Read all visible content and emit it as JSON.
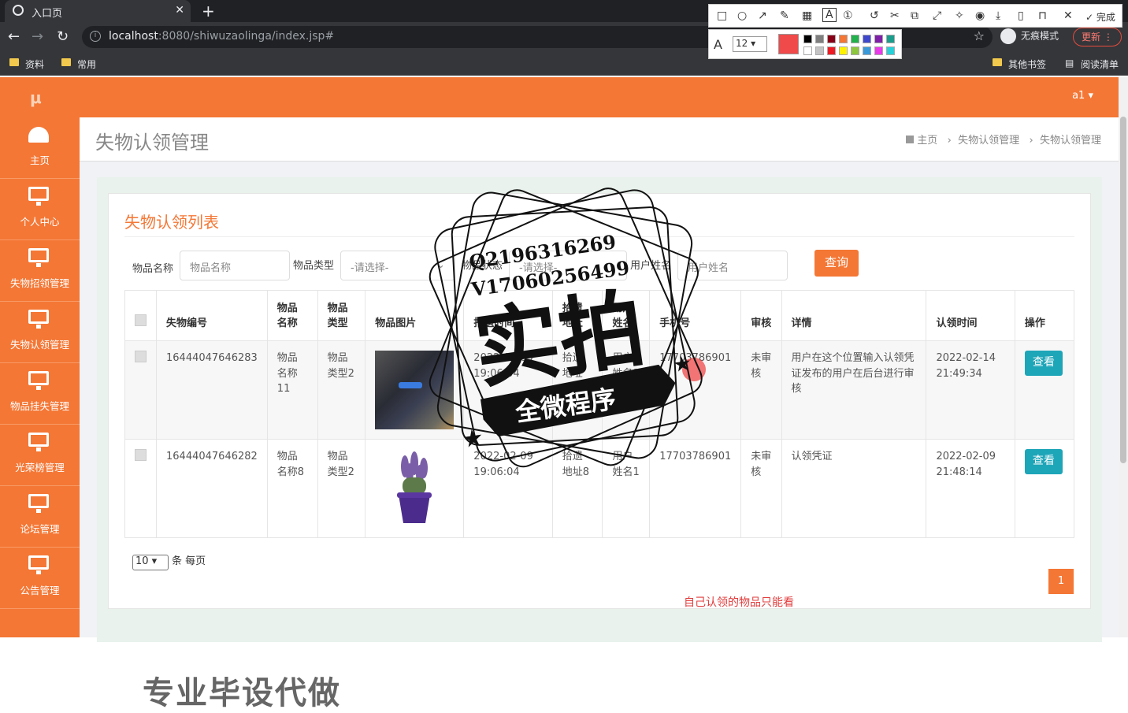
{
  "browser": {
    "tab_title": "入口页",
    "close_glyph": "✕",
    "new_tab_glyph": "+",
    "url_host": "localhost",
    "url_rest": ":8080/shiwuzaolinga/index.jsp#",
    "incognito": "无痕模式",
    "update": "更新",
    "bookmarks": [
      "资料",
      "常用"
    ],
    "other_bookmarks": "其他书签",
    "reading_list": "阅读清单"
  },
  "snap_tool": {
    "font_size": "12",
    "done": "完成",
    "selected_color": "#f04a4a"
  },
  "app": {
    "logo": "μ",
    "user": "a1 ▾",
    "sidebar": [
      "主页",
      "个人中心",
      "失物招领管理",
      "失物认领管理",
      "物品挂失管理",
      "光荣榜管理",
      "论坛管理",
      "公告管理"
    ],
    "page_title": "失物认领管理",
    "breadcrumb": [
      "主页",
      "失物认领管理",
      "失物认领管理"
    ],
    "list_title": "失物认领列表",
    "filters": {
      "name_label": "物品名称",
      "name_placeholder": "物品名称",
      "type_label": "物品类型",
      "type_value": "-请选择-",
      "status_label": "物品状态",
      "status_value": "-请选择-",
      "user_label": "用户姓名",
      "user_placeholder": "用户姓名",
      "query": "查询"
    },
    "columns": [
      "失物编号",
      "物品名称",
      "物品类型",
      "物品图片",
      "拾遗时间",
      "拾遗地址",
      "用户姓名",
      "手机号",
      "审核",
      "详情",
      "认领时间",
      "操作"
    ],
    "rows": [
      {
        "id": "16444047646283",
        "name": "物品名称11",
        "type": "物品类型2",
        "time": "2022-02-09 19:06:04",
        "addr": "拾遗地址11",
        "user": "用户姓名1",
        "phone": "17703786901",
        "audit": "未审核",
        "detail": "用户在这个位置输入认领凭证发布的用户在后台进行审核",
        "claim": "2022-02-14 21:49:34",
        "action": "查看"
      },
      {
        "id": "16444047646282",
        "name": "物品名称8",
        "type": "物品类型2",
        "time": "2022-02-09 19:06:04",
        "addr": "拾遗地址8",
        "user": "用户姓名1",
        "phone": "17703786901",
        "audit": "未审核",
        "detail": "认领凭证",
        "claim": "2022-02-09 21:48:14",
        "action": "查看"
      }
    ],
    "per_page_value": "10",
    "per_page_label": "条 每页",
    "page": "1",
    "note": "自己认领的物品只能看",
    "bottom_watermark": "专业毕设代做"
  },
  "stamp": {
    "line1": "Q2196316269",
    "line2": "V17060256499",
    "big": "实拍",
    "banner": "全微程序"
  }
}
